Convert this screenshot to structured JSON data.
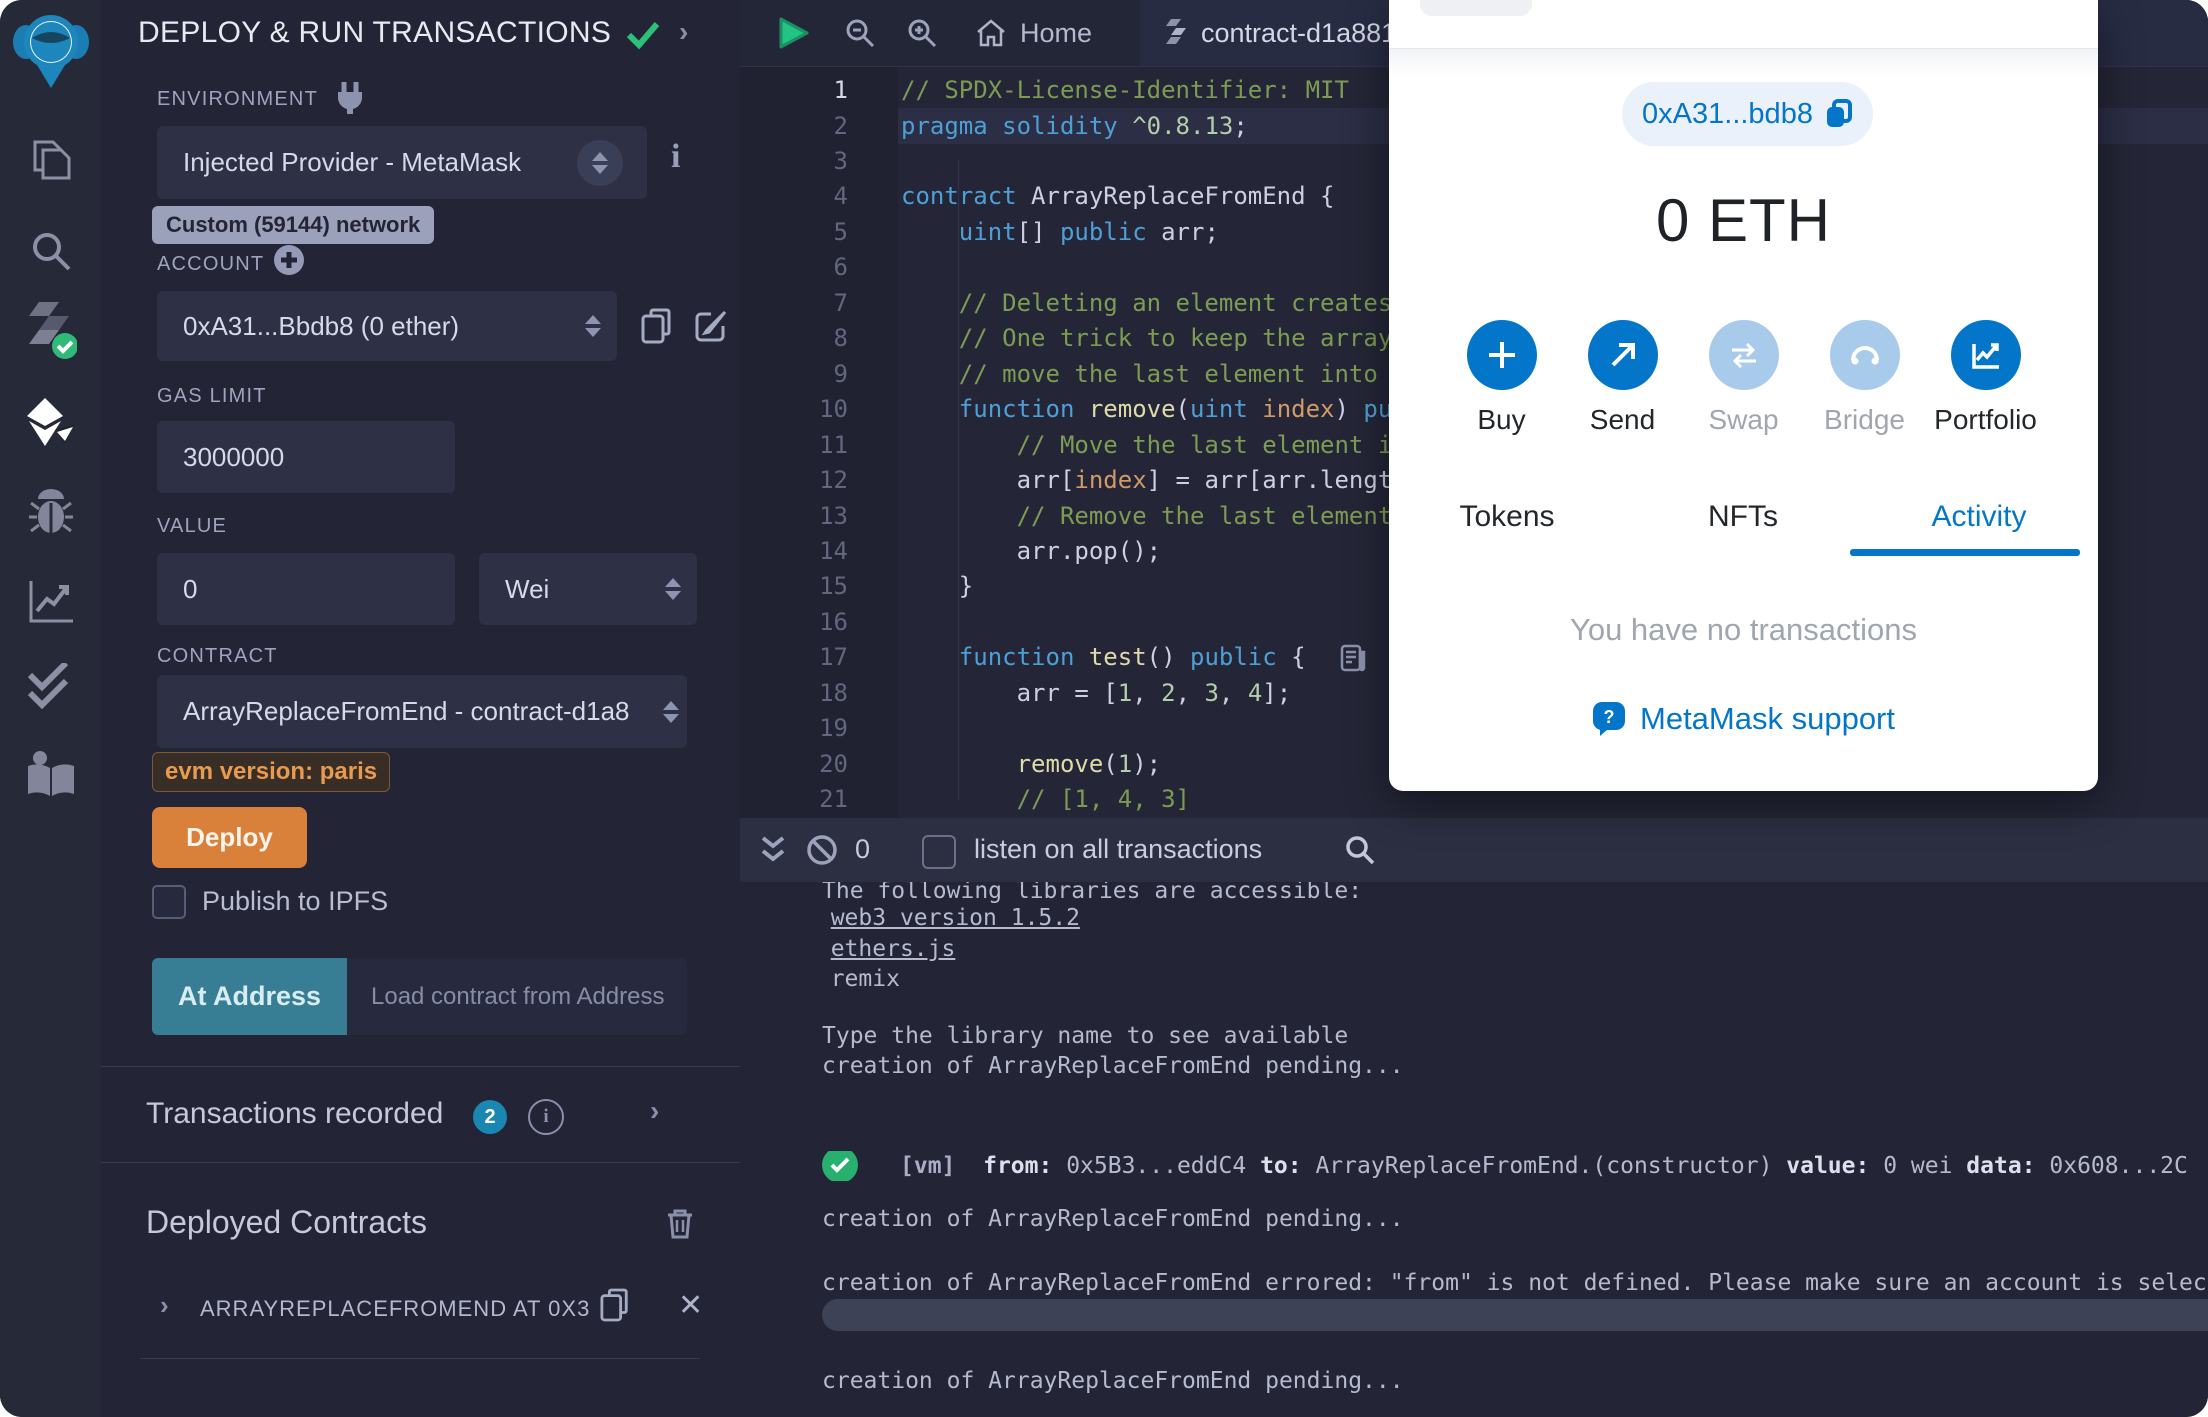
{
  "panel": {
    "title": "DEPLOY & RUN TRANSACTIONS",
    "environment": {
      "label": "ENVIRONMENT",
      "value": "Injected Provider - MetaMask",
      "badge": "Custom (59144) network"
    },
    "account": {
      "label": "ACCOUNT",
      "value": "0xA31...Bbdb8 (0 ether)"
    },
    "gas": {
      "label": "GAS LIMIT",
      "value": "3000000"
    },
    "value": {
      "label": "VALUE",
      "value": "0",
      "unit": "Wei"
    },
    "contract": {
      "label": "CONTRACT",
      "value": "ArrayReplaceFromEnd - contract-d1a8",
      "evm_badge": "evm version: paris"
    },
    "deploy_label": "Deploy",
    "publish_label": "Publish to IPFS",
    "at_address_label": "At Address",
    "load_placeholder": "Load contract from Address",
    "transactions": {
      "label": "Transactions recorded",
      "count": "2"
    },
    "deployed": {
      "title": "Deployed Contracts",
      "item": "ARRAYREPLACEFROMEND AT 0X3"
    }
  },
  "sidebar": {
    "icons": [
      "remix-logo",
      "file-explorer",
      "search",
      "solidity-compiler",
      "deploy-run",
      "debugger",
      "statistics",
      "checks",
      "learneth"
    ]
  },
  "editor": {
    "tabs": {
      "home": "Home",
      "contract": "contract-d1a881"
    },
    "lines": [
      {
        "n": 1,
        "segs": [
          [
            "// SPDX-License-Identifier: MIT",
            "com"
          ]
        ]
      },
      {
        "n": 2,
        "segs": [
          [
            "pragma",
            "kw"
          ],
          [
            " ",
            "pl"
          ],
          [
            "solidity",
            "kw"
          ],
          [
            " ",
            "pl"
          ],
          [
            "^0.8.13",
            "num"
          ],
          [
            ";",
            "pl"
          ]
        ]
      },
      {
        "n": 3,
        "segs": []
      },
      {
        "n": 4,
        "segs": [
          [
            "contract",
            "kw"
          ],
          [
            " ArrayReplaceFromEnd {",
            "pl"
          ]
        ]
      },
      {
        "n": 5,
        "segs": [
          [
            "    ",
            "pl"
          ],
          [
            "uint",
            "kw"
          ],
          [
            "[] ",
            "pl"
          ],
          [
            "public",
            "kw"
          ],
          [
            " arr;",
            "pl"
          ]
        ]
      },
      {
        "n": 6,
        "segs": []
      },
      {
        "n": 7,
        "segs": [
          [
            "    // Deleting an element creates",
            "com"
          ]
        ]
      },
      {
        "n": 8,
        "segs": [
          [
            "    // One trick to keep the array",
            "com"
          ]
        ]
      },
      {
        "n": 9,
        "segs": [
          [
            "    // move the last element into",
            "com"
          ]
        ]
      },
      {
        "n": 10,
        "segs": [
          [
            "    ",
            "pl"
          ],
          [
            "function",
            "kw"
          ],
          [
            " ",
            "pl"
          ],
          [
            "remove",
            "fn"
          ],
          [
            "(",
            "pl"
          ],
          [
            "uint",
            "kw"
          ],
          [
            " ",
            "pl"
          ],
          [
            "index",
            "par"
          ],
          [
            ") ",
            "pl"
          ],
          [
            "pu",
            "kw"
          ]
        ]
      },
      {
        "n": 11,
        "segs": [
          [
            "        // Move the last element i",
            "com"
          ]
        ]
      },
      {
        "n": 12,
        "segs": [
          [
            "        arr[",
            "pl"
          ],
          [
            "index",
            "par"
          ],
          [
            "] = arr[arr.lengt",
            "pl"
          ]
        ]
      },
      {
        "n": 13,
        "segs": [
          [
            "        // Remove the last element",
            "com"
          ]
        ]
      },
      {
        "n": 14,
        "segs": [
          [
            "        arr.pop();",
            "pl"
          ]
        ]
      },
      {
        "n": 15,
        "segs": [
          [
            "    }",
            "pl"
          ]
        ]
      },
      {
        "n": 16,
        "segs": []
      },
      {
        "n": 17,
        "segs": [
          [
            "    ",
            "pl"
          ],
          [
            "function",
            "kw"
          ],
          [
            " ",
            "pl"
          ],
          [
            "test",
            "fn"
          ],
          [
            "() ",
            "pl"
          ],
          [
            "public",
            "kw"
          ],
          [
            " {",
            "pl"
          ]
        ]
      },
      {
        "n": 18,
        "segs": [
          [
            "        arr = [",
            "pl"
          ],
          [
            "1",
            "num"
          ],
          [
            ", ",
            "pl"
          ],
          [
            "2",
            "num"
          ],
          [
            ", ",
            "pl"
          ],
          [
            "3",
            "num"
          ],
          [
            ", ",
            "pl"
          ],
          [
            "4",
            "num"
          ],
          [
            "];",
            "pl"
          ]
        ]
      },
      {
        "n": 19,
        "segs": []
      },
      {
        "n": 20,
        "segs": [
          [
            "        ",
            "pl"
          ],
          [
            "remove",
            "fn"
          ],
          [
            "(",
            "pl"
          ],
          [
            "1",
            "num"
          ],
          [
            ");",
            "pl"
          ]
        ]
      },
      {
        "n": 21,
        "segs": [
          [
            "        // [1, 4, 3]",
            "com"
          ]
        ]
      }
    ]
  },
  "terminal": {
    "count": "0",
    "listen_label": "listen on all transactions",
    "lines": [
      {
        "kind": "text",
        "text": "The following libraries are accessible:"
      },
      {
        "kind": "bullet",
        "link": true,
        "text": "web3 version 1.5.2"
      },
      {
        "kind": "bullet",
        "link": true,
        "text": "ethers.js"
      },
      {
        "kind": "bullet",
        "link": false,
        "text": "remix"
      },
      {
        "kind": "text",
        "text": "Type the library name to see available"
      },
      {
        "kind": "text",
        "text": "creation of ArrayReplaceFromEnd pending..."
      },
      {
        "kind": "vm",
        "segs": [
          [
            "[vm] ",
            "tvm"
          ],
          [
            " from: ",
            "tb"
          ],
          [
            "0x5B3...eddC4 ",
            "tr"
          ],
          [
            "to: ",
            "tb"
          ],
          [
            "ArrayReplaceFromEnd.(constructor) ",
            "tr"
          ],
          [
            "value: ",
            "tb"
          ],
          [
            "0 wei ",
            "tr"
          ],
          [
            "data: ",
            "tb"
          ],
          [
            "0x608...2C",
            "tr"
          ]
        ]
      },
      {
        "kind": "text",
        "text": "creation of ArrayReplaceFromEnd pending..."
      },
      {
        "kind": "text",
        "text": "creation of ArrayReplaceFromEnd errored: \"from\" is not defined. Please make sure an account is selected. If"
      },
      {
        "kind": "bar"
      },
      {
        "kind": "text",
        "text": "creation of ArrayReplaceFromEnd pending..."
      }
    ]
  },
  "metamask": {
    "address": "0xA31...bdb8",
    "balance": "0 ETH",
    "actions": [
      {
        "label": "Buy",
        "icon": "plus-icon",
        "enabled": true
      },
      {
        "label": "Send",
        "icon": "send-arrow-icon",
        "enabled": true
      },
      {
        "label": "Swap",
        "icon": "swap-arrows-icon",
        "enabled": false
      },
      {
        "label": "Bridge",
        "icon": "bridge-icon",
        "enabled": false
      },
      {
        "label": "Portfolio",
        "icon": "portfolio-chart-icon",
        "enabled": true
      }
    ],
    "tabs": [
      "Tokens",
      "NFTs",
      "Activity"
    ],
    "active_tab": "Activity",
    "empty_message": "You have no transactions",
    "support_label": "MetaMask support"
  },
  "colors": {
    "accent_blue": "#0376c9",
    "accent_orange": "#d9813b",
    "teal": "#377e94",
    "success_green": "#27b06e"
  }
}
